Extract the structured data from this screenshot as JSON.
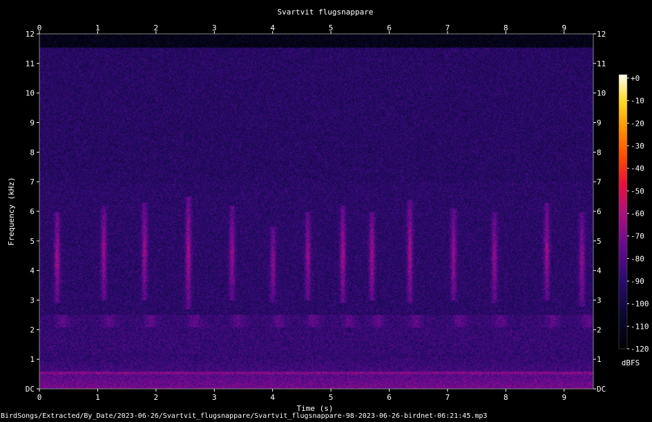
{
  "title": "Svartvit flugsnappare",
  "footer_path": "BirdSongs/Extracted/By_Date/2023-06-26/Svartvit_flugsnappare/Svartvit_flugsnappare-98-2023-06-26-birdnet-06:21:45.mp3",
  "chart_data": {
    "type": "heatmap",
    "title": "Svartvit flugsnappare",
    "xlabel": "Time (s)",
    "ylabel": "Frequency (kHz)",
    "xlim": [
      0,
      9.5
    ],
    "ylim": [
      0,
      12
    ],
    "x_ticks": [
      "0",
      "1",
      "2",
      "3",
      "4",
      "5",
      "6",
      "7",
      "8",
      "9"
    ],
    "y_ticks": [
      "DC",
      "1",
      "2",
      "3",
      "4",
      "5",
      "6",
      "7",
      "8",
      "9",
      "10",
      "11",
      "12"
    ],
    "colorbar": {
      "label": "dBFS",
      "range": [
        -120,
        0
      ],
      "ticks": [
        "+0",
        "-10",
        "-20",
        "-30",
        "-40",
        "-50",
        "-60",
        "-70",
        "-80",
        "-90",
        "-100",
        "-110",
        "-120"
      ]
    },
    "calls": [
      {
        "t": 0.3,
        "f_low": 2.9,
        "f_high": 6.0,
        "level": -70
      },
      {
        "t": 1.1,
        "f_low": 3.0,
        "f_high": 6.2,
        "level": -72
      },
      {
        "t": 1.8,
        "f_low": 3.0,
        "f_high": 6.3,
        "level": -72
      },
      {
        "t": 2.55,
        "f_low": 2.7,
        "f_high": 6.5,
        "level": -68
      },
      {
        "t": 3.3,
        "f_low": 3.0,
        "f_high": 6.2,
        "level": -74
      },
      {
        "t": 4.0,
        "f_low": 2.9,
        "f_high": 5.5,
        "level": -78
      },
      {
        "t": 4.6,
        "f_low": 3.0,
        "f_high": 6.0,
        "level": -74
      },
      {
        "t": 5.2,
        "f_low": 2.9,
        "f_high": 6.2,
        "level": -70
      },
      {
        "t": 5.7,
        "f_low": 3.0,
        "f_high": 6.0,
        "level": -70
      },
      {
        "t": 6.35,
        "f_low": 2.9,
        "f_high": 6.4,
        "level": -70
      },
      {
        "t": 7.1,
        "f_low": 3.0,
        "f_high": 6.1,
        "level": -72
      },
      {
        "t": 7.8,
        "f_low": 2.9,
        "f_high": 6.0,
        "level": -74
      },
      {
        "t": 8.7,
        "f_low": 3.0,
        "f_high": 6.3,
        "level": -72
      },
      {
        "t": 9.3,
        "f_low": 2.8,
        "f_high": 6.0,
        "level": -74
      }
    ]
  }
}
